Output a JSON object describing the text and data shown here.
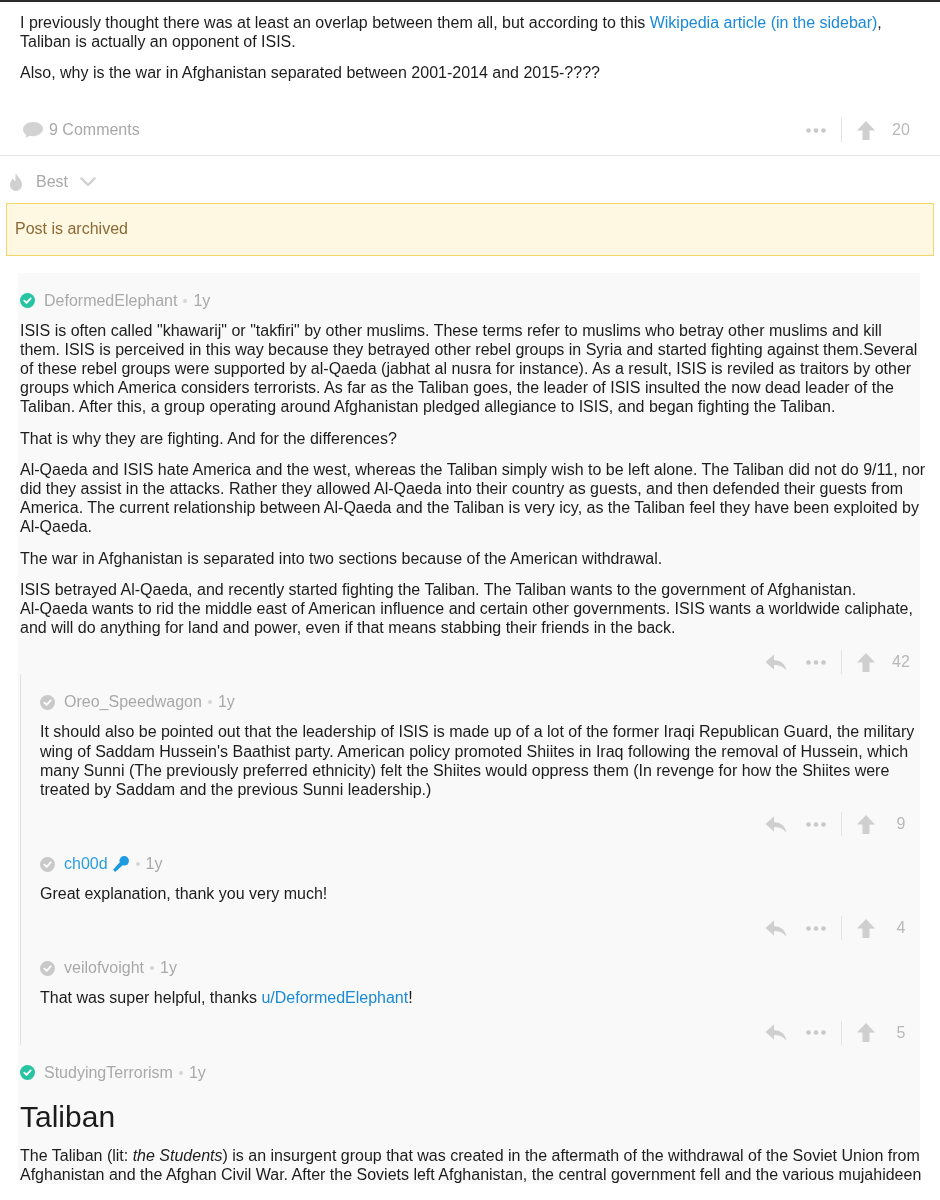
{
  "post": {
    "paragraphs": [
      {
        "parts": [
          {
            "kind": "text",
            "text": "I previously thought there was at least an overlap between them all, but according to this "
          },
          {
            "kind": "link",
            "text": "Wikipedia article (in the sidebar)"
          },
          {
            "kind": "text",
            "text": ", Taliban is actually an opponent of ISIS."
          }
        ]
      },
      {
        "parts": [
          {
            "kind": "text",
            "text": "Also, why is the war in Afghanistan separated between 2001-2014 and 2015-????"
          }
        ]
      }
    ],
    "comments_count": "9 Comments",
    "score": "20"
  },
  "sort": {
    "label": "Best"
  },
  "notice": {
    "text": "Post is archived"
  },
  "comments": [
    {
      "author": "DeformedElephant",
      "op": false,
      "age": "1y",
      "blocks": [
        {
          "kind": "paragraph",
          "parts": [
            {
              "kind": "text",
              "text": "ISIS is often called \"khawarij\" or \"takfiri\" by other muslims. These terms refer to muslims who betray other muslims and kill them. ISIS is perceived in this way because they betrayed other rebel groups in Syria and started fighting against them.Several of these rebel groups were supported by al-Qaeda (jabhat al nusra for instance). As a result, ISIS is reviled as traitors by other groups which America considers terrorists. As far as the Taliban goes, the leader of ISIS insulted the now dead leader of the Taliban. After this, a group operating around Afghanistan pledged allegiance to ISIS, and began fighting the Taliban."
            }
          ]
        },
        {
          "kind": "paragraph",
          "parts": [
            {
              "kind": "text",
              "text": "That is why they are fighting. And for the differences?"
            }
          ]
        },
        {
          "kind": "paragraph",
          "parts": [
            {
              "kind": "text",
              "text": "Al-Qaeda and ISIS hate America and the west, whereas the Taliban simply wish to be left alone. The Taliban did not do 9/11, nor did they assist in the attacks. Rather they allowed Al-Qaeda into their country as guests, and then defended their guests from America. The current relationship between Al-Qaeda and the Taliban is very icy, as the Taliban feel they have been exploited by Al-Qaeda."
            }
          ]
        },
        {
          "kind": "paragraph",
          "parts": [
            {
              "kind": "text",
              "text": "The war in Afghanistan is separated into two sections because of the American withdrawal."
            }
          ]
        },
        {
          "kind": "paragraph",
          "parts": [
            {
              "kind": "text",
              "text": "ISIS betrayed Al-Qaeda, and recently started fighting the Taliban. The Taliban wants to the government of Afghanistan.\nAl-Qaeda wants to rid the middle east of American influence and certain other governments. ISIS wants a worldwide caliphate, and will do anything for land and power, even if that means stabbing their friends in the back."
            }
          ]
        }
      ],
      "score": "42",
      "children": [
        {
          "author": "Oreo_Speedwagon",
          "op": false,
          "age": "1y",
          "blocks": [
            {
              "kind": "paragraph",
              "parts": [
                {
                  "kind": "text",
                  "text": "It should also be pointed out that the leadership of ISIS is made up of a lot of the former Iraqi Republican Guard, the military wing of Saddam Hussein's Baathist party. American policy promoted Shiites in Iraq following the removal of Hussein, which many Sunni (The previously preferred ethnicity) felt the Shiites would oppress them (In revenge for how the Shiites were treated by Saddam and the previous Sunni leadership.)"
                }
              ]
            }
          ],
          "score": "9"
        },
        {
          "author": "ch00d",
          "op": true,
          "age": "1y",
          "blocks": [
            {
              "kind": "paragraph",
              "parts": [
                {
                  "kind": "text",
                  "text": "Great explanation, thank you very much!"
                }
              ]
            }
          ],
          "score": "4"
        },
        {
          "author": "veilofvoight",
          "op": false,
          "age": "1y",
          "blocks": [
            {
              "kind": "paragraph",
              "parts": [
                {
                  "kind": "text",
                  "text": "That was super helpful, thanks "
                },
                {
                  "kind": "link",
                  "text": "u/DeformedElephant"
                },
                {
                  "kind": "text",
                  "text": "!"
                }
              ]
            }
          ],
          "score": "5"
        }
      ]
    },
    {
      "author": "StudyingTerrorism",
      "op": false,
      "age": "1y",
      "blocks": [
        {
          "kind": "heading",
          "text": "Taliban"
        },
        {
          "kind": "paragraph",
          "parts": [
            {
              "kind": "text",
              "text": "The Taliban (lit: *the Students*) is an insurgent group that was created in the aftermath of the withdrawal of the Soviet Union from Afghanistan and the Afghan Civil War. After the Soviets left Afghanistan, the central government fell and the various mujahideen"
            }
          ]
        }
      ]
    }
  ]
}
